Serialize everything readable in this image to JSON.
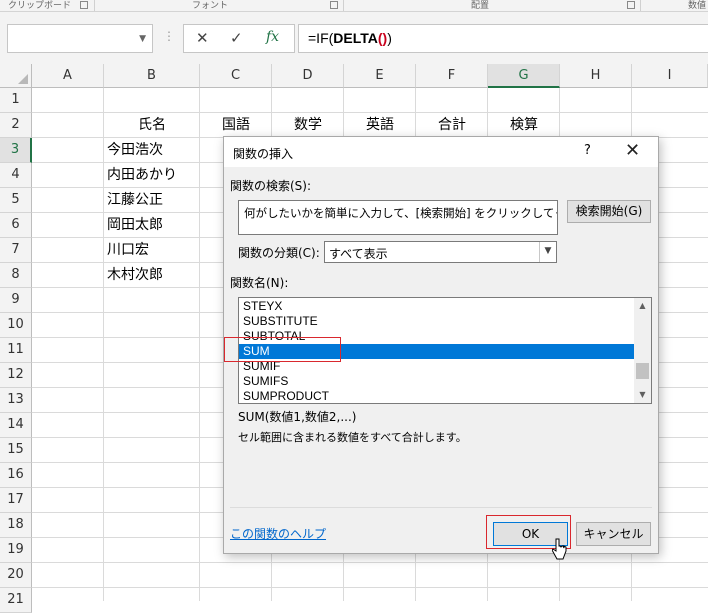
{
  "ribbon": {
    "groups": [
      "クリップボード",
      "フォント",
      "配置",
      "数値"
    ]
  },
  "formula_bar": {
    "name_box": "",
    "cancel_icon": "✕",
    "enter_icon": "✓",
    "fx_icon": "fx",
    "formula_prefix": "=IF(",
    "formula_fn": "DELTA",
    "formula_parens": "()",
    "formula_suffix": ")"
  },
  "sheet": {
    "columns": [
      "A",
      "B",
      "C",
      "D",
      "E",
      "F",
      "G",
      "H",
      "I"
    ],
    "rows": [
      "1",
      "2",
      "3",
      "4",
      "5",
      "6",
      "7",
      "8",
      "9",
      "10",
      "11",
      "12",
      "13",
      "14",
      "15",
      "16",
      "17",
      "18",
      "19",
      "20",
      "21"
    ],
    "headers": {
      "name": "氏名",
      "japanese": "国語",
      "math": "数学",
      "english": "英語",
      "total": "合計",
      "check": "検算"
    },
    "names": [
      "今田浩次",
      "内田あかり",
      "江藤公正",
      "岡田太郎",
      "川口宏",
      "木村次郎"
    ]
  },
  "dialog": {
    "title": "関数の挿入",
    "help_icon": "?",
    "close_icon": "✕",
    "search_label": "関数の検索(S):",
    "search_value": "何がしたいかを簡単に入力して、[検索開始] をクリックしてください。",
    "search_button": "検索開始(G)",
    "category_label": "関数の分類(C):",
    "category_value": "すべて表示",
    "function_name_label": "関数名(N):",
    "functions": [
      "STEYX",
      "SUBSTITUTE",
      "SUBTOTAL",
      "SUM",
      "SUMIF",
      "SUMIFS",
      "SUMPRODUCT"
    ],
    "selected_function": "SUM",
    "syntax": "SUM(数値1,数値2,...)",
    "description": "セル範囲に含まれる数値をすべて合計します。",
    "help_link": "この関数のヘルプ",
    "ok_button": "OK",
    "cancel_button": "キャンセル"
  }
}
